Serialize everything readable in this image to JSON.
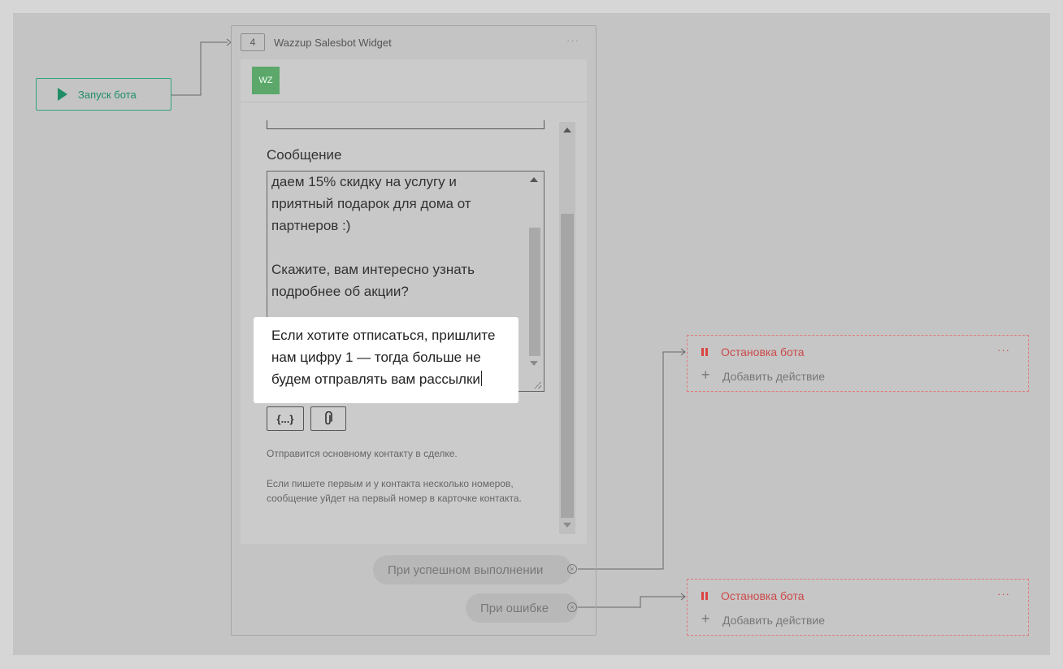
{
  "start_node": {
    "label": "Запуск бота"
  },
  "widget": {
    "step_number": "4",
    "title": "Wazzup Salesbot Widget",
    "menu": "···",
    "logo_text": "WZ",
    "message_label": "Сообщение",
    "message_lines_visible": [
      "даем 15% скидку на услугу и",
      "приятный подарок для дома от",
      "партнеров :)",
      "",
      "Скажите, вам интересно узнать",
      "подробнее об акции?"
    ],
    "highlighted_lines": [
      "Если хотите отписаться, пришлите",
      "нам цифру 1 — тогда больше не",
      "будем отправлять вам рассылки"
    ],
    "variables_button": "{...}",
    "attach_icon": "paperclip-icon",
    "note_primary": "Отправится основному контакту в сделке.",
    "note_secondary": "Если пишете первым и у контакта несколько номеров, сообщение уйдет на первый номер в карточке контакта.",
    "on_success": "При успешном выполнении",
    "on_error": "При ошибке"
  },
  "stop_nodes": [
    {
      "title": "Остановка бота",
      "menu": "···",
      "add_action": "Добавить действие"
    },
    {
      "title": "Остановка бота",
      "menu": "···",
      "add_action": "Добавить действие"
    }
  ],
  "colors": {
    "accent_green": "#1f8d66",
    "logo_green": "#5ba86a",
    "stop_red": "#cc4a4a"
  }
}
